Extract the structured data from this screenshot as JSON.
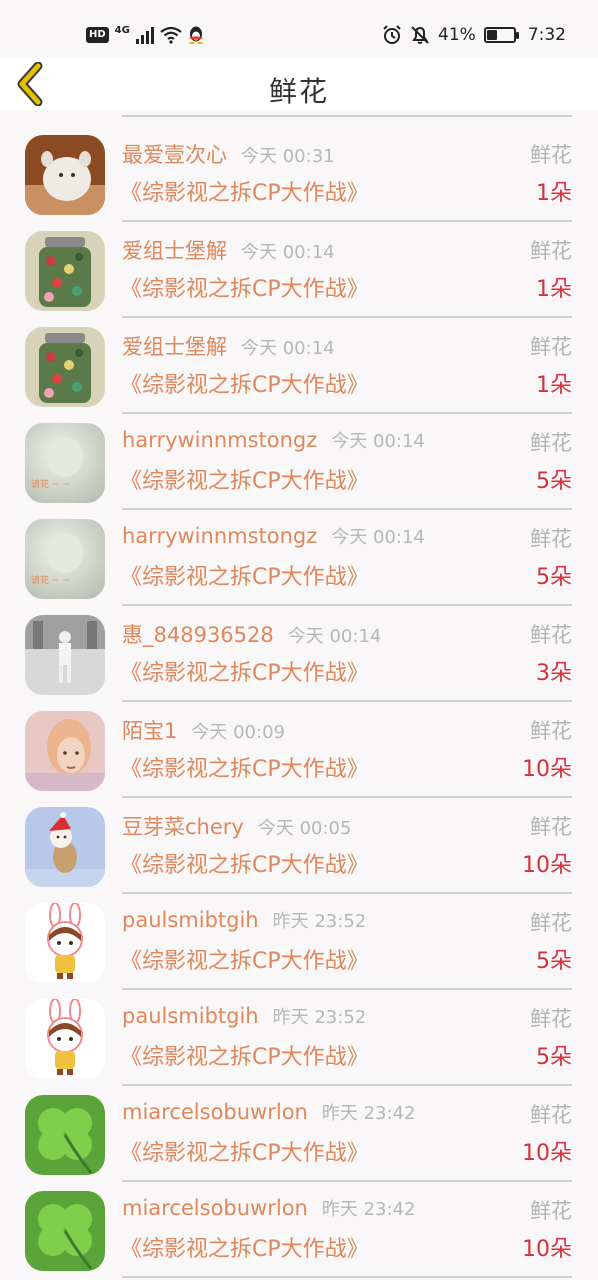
{
  "status_bar": {
    "network": "4G",
    "hd": "HD",
    "battery_text": "41%",
    "battery_level": 0.41,
    "time": "7:32"
  },
  "header": {
    "title": "鲜花"
  },
  "items": [
    {
      "name": "最爱壹次心",
      "time": "今天 00:31",
      "label": "鲜花",
      "book": "《综影视之拆CP大作战》",
      "count": "1朵",
      "avatar": "cat"
    },
    {
      "name": "爱组士堡解",
      "time": "今天 00:14",
      "label": "鲜花",
      "book": "《综影视之拆CP大作战》",
      "count": "1朵",
      "avatar": "jar"
    },
    {
      "name": "爱组士堡解",
      "time": "今天 00:14",
      "label": "鲜花",
      "book": "《综影视之拆CP大作战》",
      "count": "1朵",
      "avatar": "jar"
    },
    {
      "name": "harrywinnmstongz",
      "time": "今天 00:14",
      "label": "鲜花",
      "book": "《综影视之拆CP大作战》",
      "count": "5朵",
      "avatar": "mist"
    },
    {
      "name": "harrywinnmstongz",
      "time": "今天 00:14",
      "label": "鲜花",
      "book": "《综影视之拆CP大作战》",
      "count": "5朵",
      "avatar": "mist"
    },
    {
      "name": "惠_848936528",
      "time": "今天 00:14",
      "label": "鲜花",
      "book": "《综影视之拆CP大作战》",
      "count": "3朵",
      "avatar": "room"
    },
    {
      "name": "陌宝1",
      "time": "今天 00:09",
      "label": "鲜花",
      "book": "《综影视之拆CP大作战》",
      "count": "10朵",
      "avatar": "girl"
    },
    {
      "name": "豆芽菜chery",
      "time": "今天 00:05",
      "label": "鲜花",
      "book": "《综影视之拆CP大作战》",
      "count": "10朵",
      "avatar": "dog"
    },
    {
      "name": "paulsmibtgih",
      "time": "昨天 23:52",
      "label": "鲜花",
      "book": "《综影视之拆CP大作战》",
      "count": "5朵",
      "avatar": "bunny"
    },
    {
      "name": "paulsmibtgih",
      "time": "昨天 23:52",
      "label": "鲜花",
      "book": "《综影视之拆CP大作战》",
      "count": "5朵",
      "avatar": "bunny"
    },
    {
      "name": "miarcelsobuwrlon",
      "time": "昨天 23:42",
      "label": "鲜花",
      "book": "《综影视之拆CP大作战》",
      "count": "10朵",
      "avatar": "clover"
    },
    {
      "name": "miarcelsobuwrlon",
      "time": "昨天 23:42",
      "label": "鲜花",
      "book": "《综影视之拆CP大作战》",
      "count": "10朵",
      "avatar": "clover"
    }
  ],
  "colors": {
    "name": "#e0885b",
    "count": "#d6303c",
    "muted": "#b7b7b7",
    "back_arrow": "#e5c200"
  }
}
